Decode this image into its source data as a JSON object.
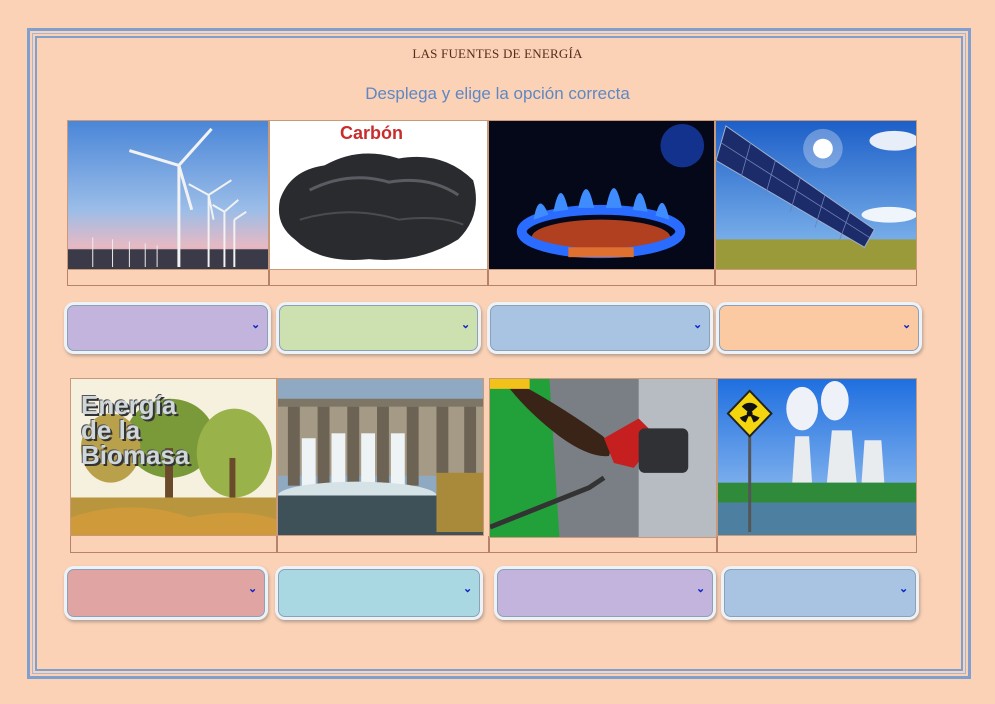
{
  "header": {
    "title": "LAS FUENTES DE ENERGÍA",
    "instruction": "Desplega y elige la opción correcta"
  },
  "images": [
    {
      "name": "wind-turbines-image",
      "caption_text": ""
    },
    {
      "name": "coal-image",
      "caption_text": "Carbón"
    },
    {
      "name": "gas-burner-image",
      "caption_text": ""
    },
    {
      "name": "solar-panel-image",
      "caption_text": ""
    },
    {
      "name": "biomass-image",
      "caption_text": "Energía de la Biomasa"
    },
    {
      "name": "hydro-dam-image",
      "caption_text": ""
    },
    {
      "name": "fuel-pump-image",
      "caption_text": ""
    },
    {
      "name": "nuclear-plant-image",
      "caption_text": ""
    }
  ],
  "selects": [
    {
      "value": "",
      "color": "#c2b4dc"
    },
    {
      "value": "",
      "color": "#cde0b0"
    },
    {
      "value": "",
      "color": "#a9c3e2"
    },
    {
      "value": "",
      "color": "#fbcaa2"
    },
    {
      "value": "",
      "color": "#e0a4a2"
    },
    {
      "value": "",
      "color": "#a9d8e3"
    },
    {
      "value": "",
      "color": "#c2b4dc"
    },
    {
      "value": "",
      "color": "#a9c3e2"
    }
  ],
  "icons": {
    "chevron": "⌄"
  }
}
